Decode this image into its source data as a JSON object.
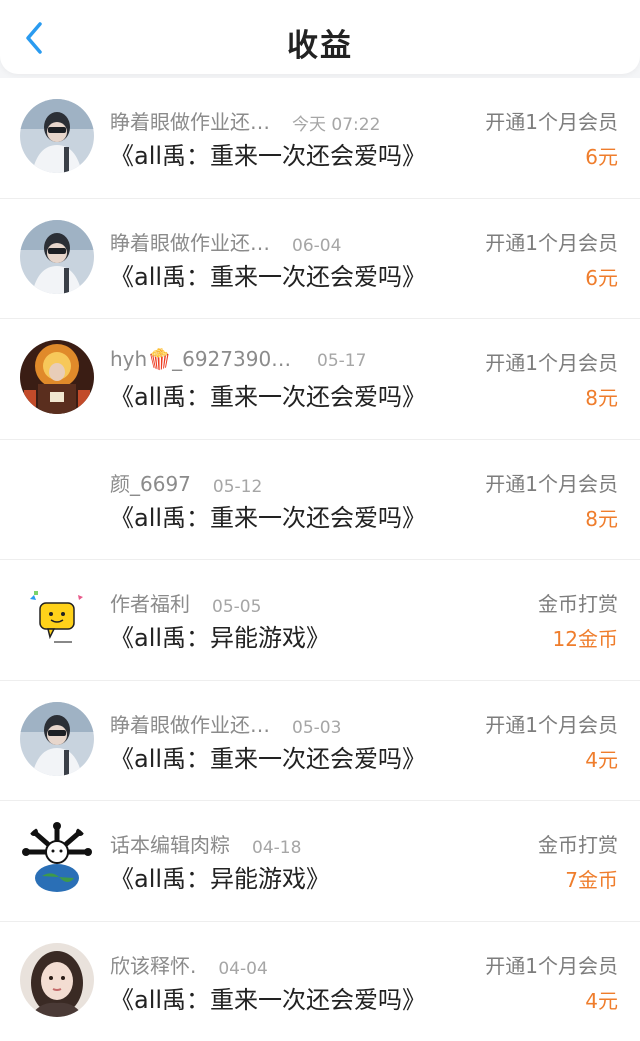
{
  "header": {
    "title": "收益"
  },
  "records": [
    {
      "user": "睁着眼做作业还…",
      "time": "今天 07:22",
      "book": "《all禹：重来一次还会爱吗》",
      "type": "开通1个月会员",
      "amount": "6元"
    },
    {
      "user": "睁着眼做作业还…",
      "time": "06-04",
      "book": "《all禹：重来一次还会爱吗》",
      "type": "开通1个月会员",
      "amount": "6元"
    },
    {
      "user": "hyh🍿_69273906…",
      "time": "05-17",
      "book": "《all禹：重来一次还会爱吗》",
      "type": "开通1个月会员",
      "amount": "8元"
    },
    {
      "user": "颜_6697",
      "time": "05-12",
      "book": "《all禹：重来一次还会爱吗》",
      "type": "开通1个月会员",
      "amount": "8元"
    },
    {
      "user": "作者福利",
      "time": "05-05",
      "book": "《all禹：异能游戏》",
      "type": "金币打赏",
      "amount": "12金币"
    },
    {
      "user": "睁着眼做作业还…",
      "time": "05-03",
      "book": "《all禹：重来一次还会爱吗》",
      "type": "开通1个月会员",
      "amount": "4元"
    },
    {
      "user": "话本编辑肉粽",
      "time": "04-18",
      "book": "《all禹：异能游戏》",
      "type": "金币打赏",
      "amount": "7金币"
    },
    {
      "user": "欣该释怀.",
      "time": "04-04",
      "book": "《all禹：重来一次还会爱吗》",
      "type": "开通1个月会员",
      "amount": "4元"
    }
  ],
  "colors": {
    "accent": "#2a9bf0",
    "amount": "#ef7d2c"
  }
}
